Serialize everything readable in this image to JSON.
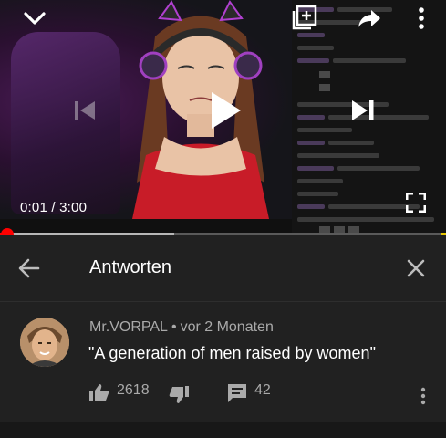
{
  "player": {
    "current_time": "0:01",
    "separator": "/",
    "duration": "3:00",
    "progress_fraction": 0.0056,
    "buffered_fraction": 0.39
  },
  "replies_panel": {
    "title": "Antworten"
  },
  "comment": {
    "author": "Mr.VORPAL",
    "separator": "•",
    "age": "vor 2 Monaten",
    "text": "\"A generation of men raised by women\"",
    "likes": "2618",
    "replies": "42"
  },
  "colors": {
    "accent_red": "#ff0000",
    "panel_bg": "#212121",
    "secondary_text": "#aaaaaa"
  }
}
